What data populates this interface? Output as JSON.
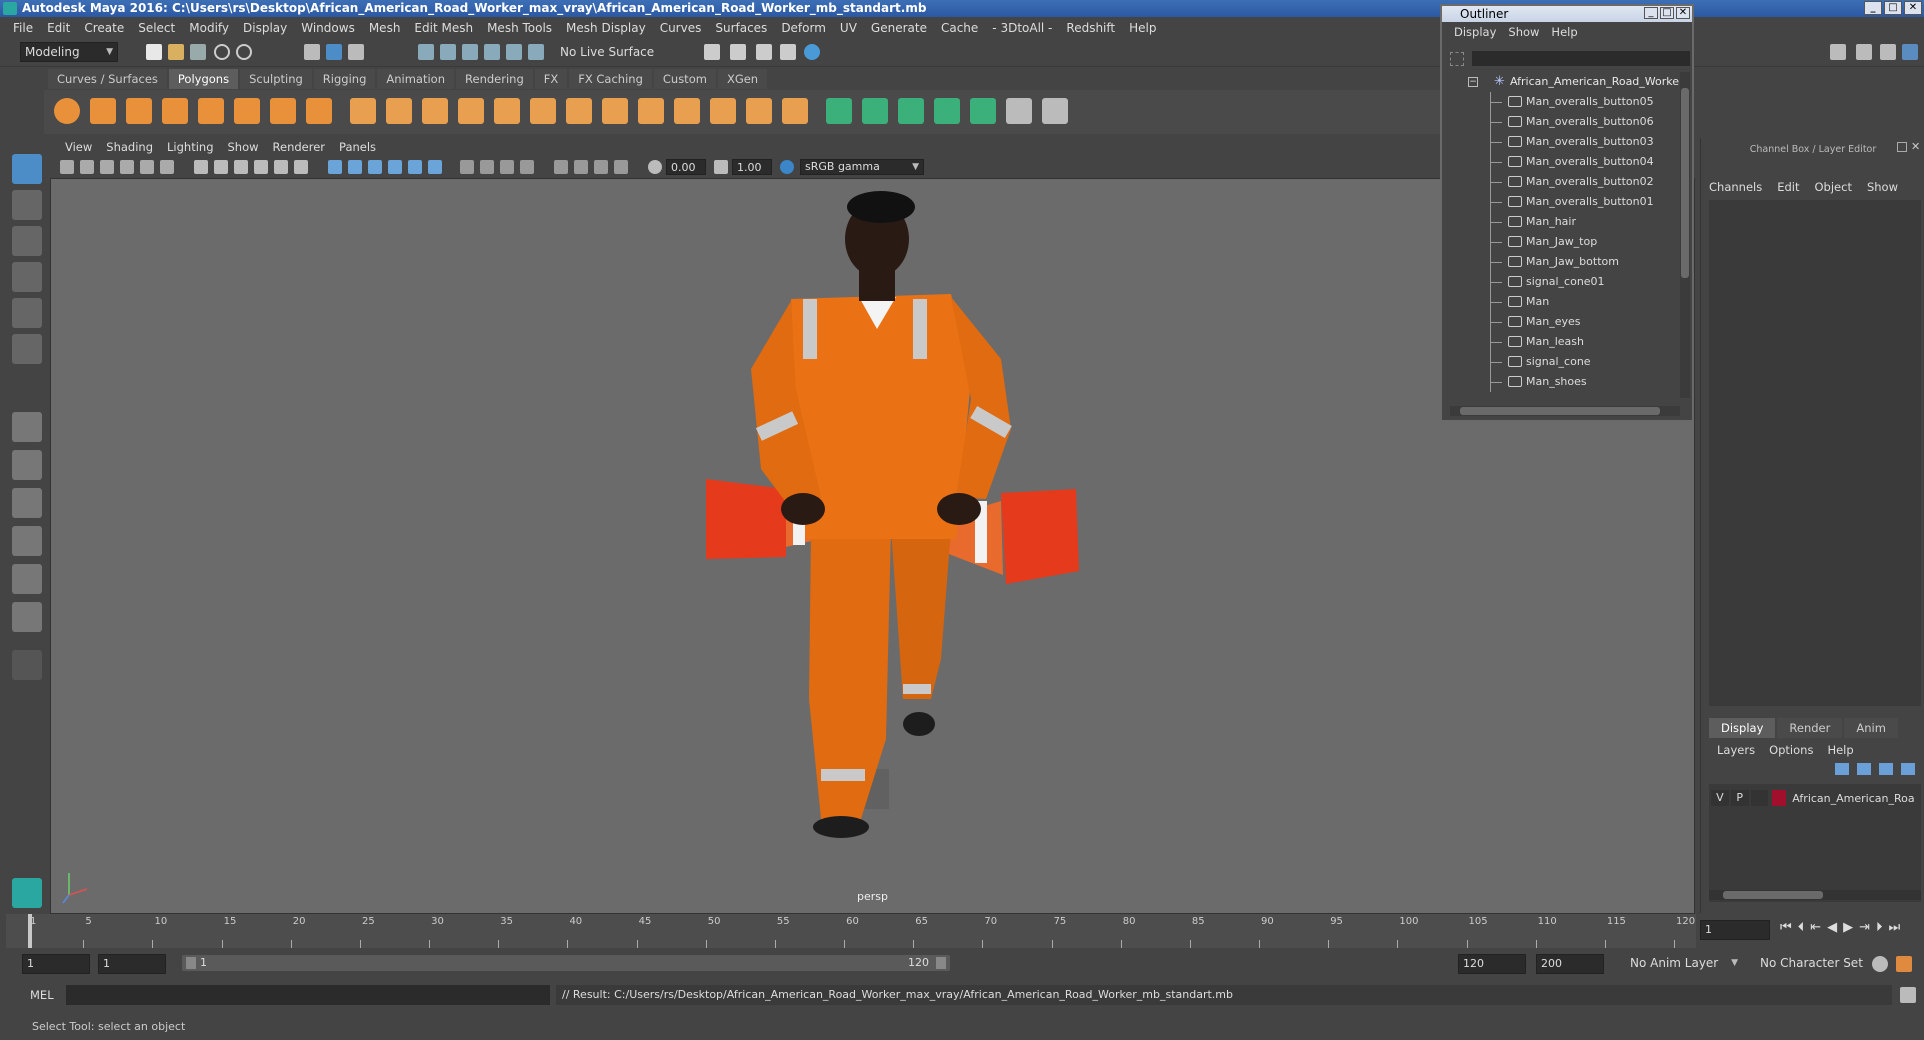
{
  "window": {
    "title": "Autodesk Maya 2016: C:\\Users\\rs\\Desktop\\African_American_Road_Worker_max_vray\\African_American_Road_Worker_mb_standart.mb",
    "minimize": "_",
    "maximize": "□",
    "close": "✕"
  },
  "menubar": [
    "File",
    "Edit",
    "Create",
    "Select",
    "Modify",
    "Display",
    "Windows",
    "Mesh",
    "Edit Mesh",
    "Mesh Tools",
    "Mesh Display",
    "Curves",
    "Surfaces",
    "Deform",
    "UV",
    "Generate",
    "Cache",
    "- 3DtoAll -",
    "Redshift",
    "Help"
  ],
  "statusline": {
    "mode": "Modeling",
    "live_surface": "No Live Surface"
  },
  "shelf": {
    "tabs": [
      "Curves / Surfaces",
      "Polygons",
      "Sculpting",
      "Rigging",
      "Animation",
      "Rendering",
      "FX",
      "FX Caching",
      "Custom",
      "XGen"
    ],
    "active_tab": "Polygons"
  },
  "viewport": {
    "menus": [
      "View",
      "Shading",
      "Lighting",
      "Show",
      "Renderer",
      "Panels"
    ],
    "exposure": "0.00",
    "gamma": "1.00",
    "color_space": "sRGB gamma",
    "camera_label": "persp"
  },
  "outliner": {
    "title": "Outliner",
    "menus": [
      "Display",
      "Show",
      "Help"
    ],
    "root": "African_American_Road_Worker_",
    "items": [
      "Man_overalls_button05",
      "Man_overalls_button06",
      "Man_overalls_button03",
      "Man_overalls_button04",
      "Man_overalls_button02",
      "Man_overalls_button01",
      "Man_hair",
      "Man_Jaw_top",
      "Man_Jaw_bottom",
      "signal_cone01",
      "Man",
      "Man_eyes",
      "Man_leash",
      "signal_cone",
      "Man_shoes"
    ]
  },
  "channel_box": {
    "title": "Channel Box / Layer Editor",
    "menus": [
      "Channels",
      "Edit",
      "Object",
      "Show"
    ],
    "layer_tabs": [
      "Display",
      "Render",
      "Anim"
    ],
    "layer_menus": [
      "Layers",
      "Options",
      "Help"
    ],
    "layer": {
      "visible": "V",
      "playback": "P",
      "name": "African_American_Roa",
      "color": "#a0102c"
    }
  },
  "timeline": {
    "ticks": [
      "1",
      "5",
      "10",
      "15",
      "20",
      "25",
      "30",
      "35",
      "40",
      "45",
      "50",
      "55",
      "60",
      "65",
      "70",
      "75",
      "80",
      "85",
      "90",
      "95",
      "100",
      "105",
      "110",
      "115",
      "120"
    ],
    "current_frame": "1"
  },
  "range": {
    "start": "1",
    "playback_start": "1",
    "slider_start": "1",
    "slider_end": "120",
    "playback_end": "120",
    "end": "200",
    "anim_layer": "No Anim Layer",
    "character_set": "No Character Set"
  },
  "command_line": {
    "language": "MEL",
    "result": "// Result: C:/Users/rs/Desktop/African_American_Road_Worker_max_vray/African_American_Road_Worker_mb_standart.mb"
  },
  "help_line": "Select Tool: select an object"
}
